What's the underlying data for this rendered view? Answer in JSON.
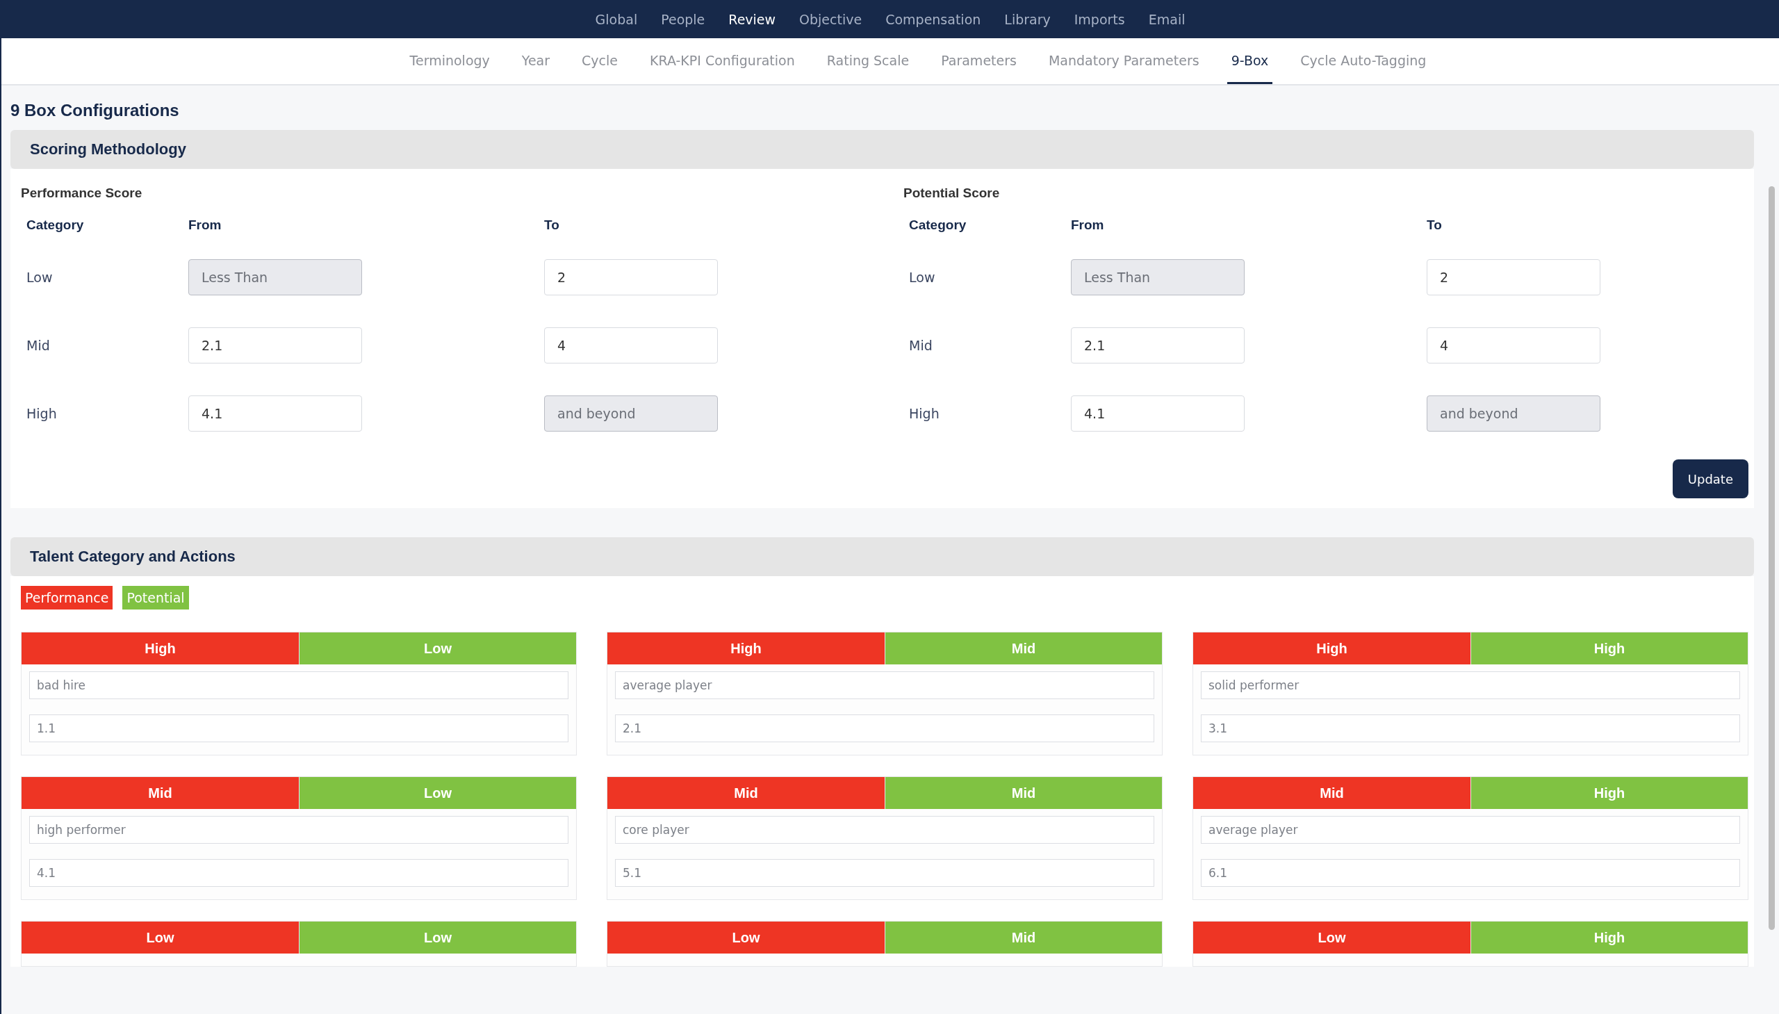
{
  "top_nav": [
    {
      "label": "Global",
      "selected": false
    },
    {
      "label": "People",
      "selected": false
    },
    {
      "label": "Review",
      "selected": true
    },
    {
      "label": "Objective",
      "selected": false
    },
    {
      "label": "Compensation",
      "selected": false
    },
    {
      "label": "Library",
      "selected": false
    },
    {
      "label": "Imports",
      "selected": false
    },
    {
      "label": "Email",
      "selected": false
    }
  ],
  "sub_nav": [
    {
      "label": "Terminology",
      "selected": false
    },
    {
      "label": "Year",
      "selected": false
    },
    {
      "label": "Cycle",
      "selected": false
    },
    {
      "label": "KRA-KPI Configuration",
      "selected": false
    },
    {
      "label": "Rating Scale",
      "selected": false
    },
    {
      "label": "Parameters",
      "selected": false
    },
    {
      "label": "Mandatory Parameters",
      "selected": false
    },
    {
      "label": "9-Box",
      "selected": true
    },
    {
      "label": "Cycle Auto-Tagging",
      "selected": false
    }
  ],
  "page_title": "9 Box Configurations",
  "scoring": {
    "title": "Scoring Methodology",
    "button": "Update",
    "scores": [
      {
        "title": "Performance Score",
        "columns": [
          "Category",
          "From",
          "To"
        ],
        "rows": [
          {
            "category": "Low",
            "from": {
              "value": "Less Than",
              "disabled": true
            },
            "to": {
              "value": "2",
              "disabled": false
            }
          },
          {
            "category": "Mid",
            "from": {
              "value": "2.1",
              "disabled": false
            },
            "to": {
              "value": "4",
              "disabled": false
            }
          },
          {
            "category": "High",
            "from": {
              "value": "4.1",
              "disabled": false
            },
            "to": {
              "value": "and beyond",
              "disabled": true
            }
          }
        ]
      },
      {
        "title": "Potential Score",
        "columns": [
          "Category",
          "From",
          "To"
        ],
        "rows": [
          {
            "category": "Low",
            "from": {
              "value": "Less Than",
              "disabled": true
            },
            "to": {
              "value": "2",
              "disabled": false
            }
          },
          {
            "category": "Mid",
            "from": {
              "value": "2.1",
              "disabled": false
            },
            "to": {
              "value": "4",
              "disabled": false
            }
          },
          {
            "category": "High",
            "from": {
              "value": "4.1",
              "disabled": false
            },
            "to": {
              "value": "and beyond",
              "disabled": true
            }
          }
        ]
      }
    ]
  },
  "talent": {
    "title": "Talent Category and Actions",
    "legend": [
      {
        "label": "Performance",
        "color": "#ee3524"
      },
      {
        "label": "Potential",
        "color": "#80c242"
      }
    ],
    "boxes": [
      {
        "performance": "High",
        "potential": "Low",
        "name": "bad hire",
        "value": "1.1"
      },
      {
        "performance": "High",
        "potential": "Mid",
        "name": "average player",
        "value": "2.1"
      },
      {
        "performance": "High",
        "potential": "High",
        "name": "solid performer",
        "value": "3.1"
      },
      {
        "performance": "Mid",
        "potential": "Low",
        "name": "high performer",
        "value": "4.1"
      },
      {
        "performance": "Mid",
        "potential": "Mid",
        "name": "core player",
        "value": "5.1"
      },
      {
        "performance": "Mid",
        "potential": "High",
        "name": "average player",
        "value": "6.1"
      },
      {
        "performance": "Low",
        "potential": "Low"
      },
      {
        "performance": "Low",
        "potential": "Mid"
      },
      {
        "performance": "Low",
        "potential": "High"
      }
    ]
  }
}
